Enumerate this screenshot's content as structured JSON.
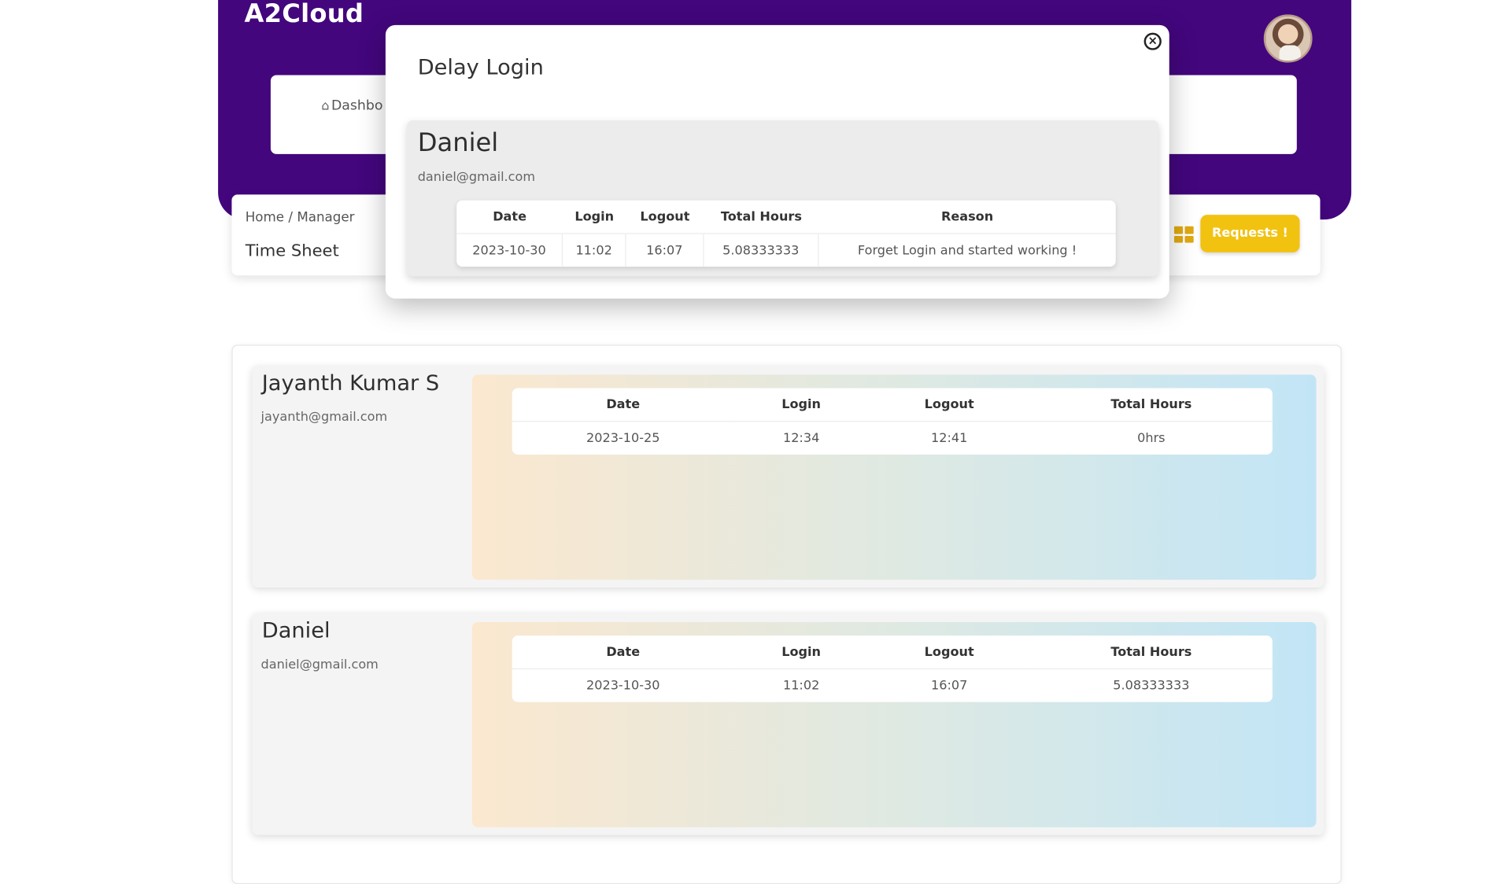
{
  "app": {
    "brand": "A2Cloud"
  },
  "nav": {
    "dashboard_label": "Dashbo"
  },
  "breadcrumb": {
    "path": "Home / Manager",
    "title": "Time Sheet"
  },
  "toolbar": {
    "requests_label": "Requests !",
    "grid_icon": "grid-icon",
    "accent_color": "#f2c210"
  },
  "colors": {
    "header": "#43067d"
  },
  "modal": {
    "title": "Delay Login",
    "close_icon": "close-circle-icon",
    "employee": {
      "name": "Daniel",
      "email": "daniel@gmail.com"
    },
    "columns": [
      "Date",
      "Login",
      "Logout",
      "Total Hours",
      "Reason"
    ],
    "row": {
      "date": "2023-10-30",
      "login": "11:02",
      "logout": "16:07",
      "total": "5.08333333",
      "reason": "Forget Login and started working !"
    }
  },
  "timesheet": {
    "columns": [
      "Date",
      "Login",
      "Logout",
      "Total Hours"
    ],
    "employees": [
      {
        "name": "Jayanth Kumar S",
        "email": "jayanth@gmail.com",
        "date": "2023-10-25",
        "login": "12:34",
        "logout": "12:41",
        "total": "0hrs"
      },
      {
        "name": "Daniel",
        "email": "daniel@gmail.com",
        "date": "2023-10-30",
        "login": "11:02",
        "logout": "16:07",
        "total": "5.08333333"
      }
    ]
  }
}
